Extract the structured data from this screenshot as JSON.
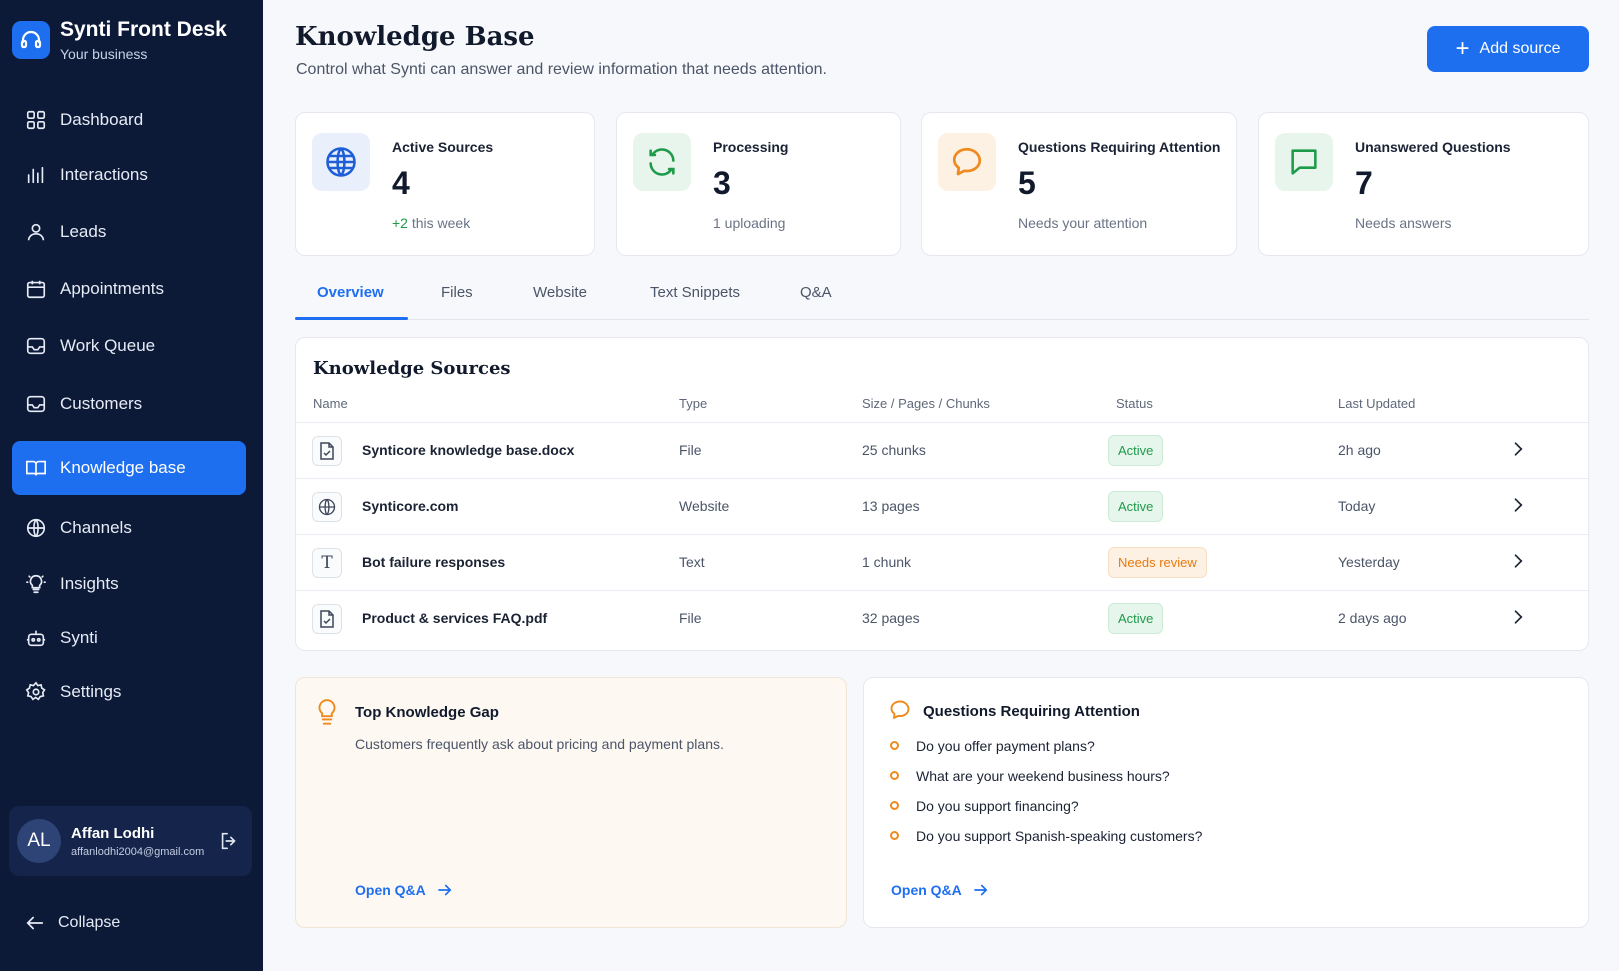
{
  "app": {
    "title": "Synti Front Desk",
    "subtitle": "Your business"
  },
  "sidebar": {
    "items": [
      {
        "label": "Dashboard",
        "icon": "dashboard-icon"
      },
      {
        "label": "Interactions",
        "icon": "bar-chart-icon"
      },
      {
        "label": "Leads",
        "icon": "user-icon"
      },
      {
        "label": "Appointments",
        "icon": "calendar-icon"
      },
      {
        "label": "Work Queue",
        "icon": "inbox-icon"
      },
      {
        "label": "Customers",
        "icon": "inbox-icon"
      },
      {
        "label": "Knowledge base",
        "icon": "book-icon",
        "active": true
      },
      {
        "label": "Channels",
        "icon": "globe-icon"
      },
      {
        "label": "Insights",
        "icon": "lightbulb-icon"
      },
      {
        "label": "Synti",
        "icon": "bot-icon"
      },
      {
        "label": "Settings",
        "icon": "gear-icon"
      }
    ],
    "user": {
      "initials": "AL",
      "name": "Affan Lodhi",
      "email": "affanlodhi2004@gmail.com"
    },
    "collapse_label": "Collapse"
  },
  "header": {
    "title": "Knowledge Base",
    "subtitle": "Control what Synti can answer and review information that needs attention.",
    "add_button": "Add source"
  },
  "stats": [
    {
      "label": "Active Sources",
      "value": "4",
      "note_highlight": "+2",
      "note": " this week",
      "icon": "globe-icon"
    },
    {
      "label": "Processing",
      "value": "3",
      "note_highlight": "",
      "note": "1 uploading",
      "icon": "refresh-icon"
    },
    {
      "label": "Questions Requiring Attention",
      "value": "5",
      "note_highlight": "",
      "note": "Needs your attention",
      "icon": "chat-bubble-icon"
    },
    {
      "label": "Unanswered Questions",
      "value": "7",
      "note_highlight": "",
      "note": "Needs answers",
      "icon": "message-square-icon"
    }
  ],
  "tabs": [
    "Overview",
    "Files",
    "Website",
    "Text Snippets",
    "Q&A"
  ],
  "sources": {
    "title": "Knowledge Sources",
    "columns": [
      "Name",
      "Type",
      "Size / Pages / Chunks",
      "Status",
      "Last Updated"
    ],
    "rows": [
      {
        "name": "Synticore knowledge base.docx",
        "type": "File",
        "size": "25 chunks",
        "status": "Active",
        "updated": "2h ago",
        "icon": "file-icon"
      },
      {
        "name": "Synticore.com",
        "type": "Website",
        "size": "13 pages",
        "status": "Active",
        "updated": "Today",
        "icon": "globe-icon"
      },
      {
        "name": "Bot failure responses",
        "type": "Text",
        "size": "1 chunk",
        "status": "Needs review",
        "updated": "Yesterday",
        "icon": "text-icon"
      },
      {
        "name": "Product & services FAQ.pdf",
        "type": "File",
        "size": "32 pages",
        "status": "Active",
        "updated": "2 days ago",
        "icon": "file-icon"
      }
    ]
  },
  "gap": {
    "title": "Top Knowledge Gap",
    "description": "Customers frequently ask about pricing and payment plans.",
    "link": "Open Q&A"
  },
  "attention": {
    "title": "Questions Requiring Attention",
    "questions": [
      "Do you offer payment plans?",
      "What are your weekend business hours?",
      "Do you support financing?",
      "Do you support Spanish-speaking customers?"
    ],
    "link": "Open Q&A"
  },
  "colors": {
    "sidebar_bg": "#0c1a38",
    "accent": "#1e6ff0",
    "active_status": "#1e9b4a",
    "review_status": "#e67a12"
  }
}
